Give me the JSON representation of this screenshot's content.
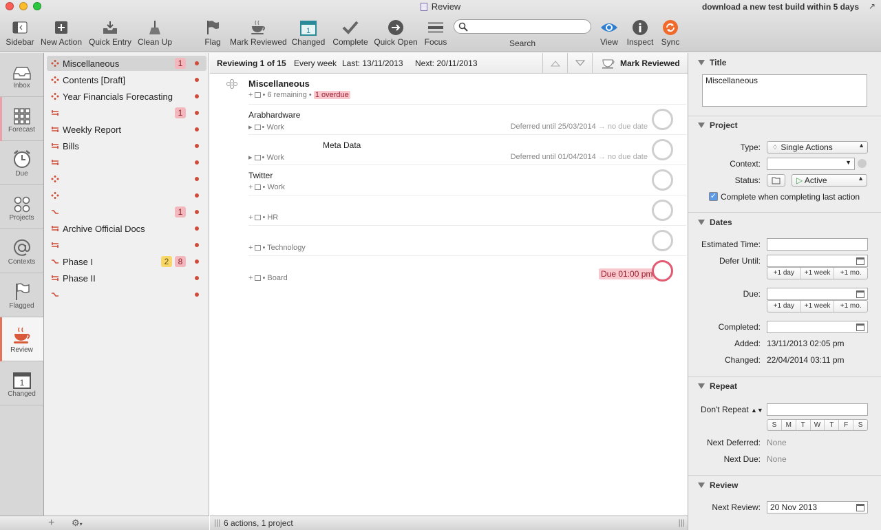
{
  "window": {
    "title": "Review",
    "notice": "download a new test build within 5 days"
  },
  "toolbar": {
    "sidebar": "Sidebar",
    "new_action": "New Action",
    "quick_entry": "Quick Entry",
    "clean_up": "Clean Up",
    "flag": "Flag",
    "mark_reviewed": "Mark Reviewed",
    "changed": "Changed",
    "changed_day": "1",
    "complete": "Complete",
    "quick_open": "Quick Open",
    "focus": "Focus",
    "search_label": "Search",
    "search_placeholder": "",
    "view": "View",
    "inspect": "Inspect",
    "sync": "Sync"
  },
  "perspectives": [
    {
      "label": "Inbox",
      "icon": "inbox-icon"
    },
    {
      "label": "Forecast",
      "icon": "forecast-icon"
    },
    {
      "label": "Due",
      "icon": "alarm-clock-icon"
    },
    {
      "label": "Projects",
      "icon": "projects-icon"
    },
    {
      "label": "Contexts",
      "icon": "at-sign-icon"
    },
    {
      "label": "Flagged",
      "icon": "flag-icon"
    },
    {
      "label": "Review",
      "icon": "teacup-icon"
    },
    {
      "label": "Changed",
      "icon": "calendar-icon",
      "day": "1"
    }
  ],
  "colors": {
    "accent_red": "#d24b38",
    "forecast_bar": "#e8a1a8",
    "review_bar": "#e2735c"
  },
  "projects": [
    {
      "name": "Miscellaneous",
      "type": "single",
      "badges": [
        {
          "v": "1",
          "c": "red"
        }
      ],
      "selected": true
    },
    {
      "name": "Contents [Draft]",
      "type": "single",
      "badges": []
    },
    {
      "name": "Year Financials Forecasting",
      "type": "single",
      "badges": []
    },
    {
      "name": "",
      "type": "parallel",
      "badges": [
        {
          "v": "1",
          "c": "red"
        }
      ]
    },
    {
      "name": "Weekly Report",
      "type": "parallel",
      "badges": []
    },
    {
      "name": "Bills",
      "type": "parallel",
      "badges": []
    },
    {
      "name": "",
      "type": "parallel",
      "badges": []
    },
    {
      "name": "",
      "type": "single",
      "badges": []
    },
    {
      "name": "",
      "type": "single",
      "badges": []
    },
    {
      "name": "",
      "type": "sequential",
      "badges": [
        {
          "v": "1",
          "c": "red"
        }
      ]
    },
    {
      "name": "Archive Official Docs",
      "type": "parallel",
      "badges": []
    },
    {
      "name": "",
      "type": "parallel",
      "badges": []
    },
    {
      "name": "Phase I",
      "type": "sequential",
      "badges": [
        {
          "v": "2",
          "c": "yel"
        },
        {
          "v": "8",
          "c": "red"
        }
      ]
    },
    {
      "name": "Phase II",
      "type": "parallel",
      "badges": []
    },
    {
      "name": "",
      "type": "sequential",
      "badges": []
    }
  ],
  "review": {
    "reviewing": "Reviewing 1 of 15",
    "interval": "Every week",
    "last": "Last: 13/11/2013",
    "next": "Next: 20/11/2013",
    "mark_reviewed": "Mark Reviewed"
  },
  "project": {
    "name": "Miscellaneous",
    "remaining": "6 remaining",
    "overdue": "1 overdue"
  },
  "actions": [
    {
      "title": "Arabhardware",
      "context": "Work",
      "deferred": "Deferred until 25/03/2014",
      "due": "no due date"
    },
    {
      "title": "Meta Data",
      "context": "Work",
      "deferred": "Deferred until 01/04/2014",
      "due": "no due date"
    },
    {
      "title": "Twitter",
      "context": "Work",
      "deferred": "",
      "due": ""
    },
    {
      "title": "",
      "context": "HR",
      "deferred": "",
      "due": ""
    },
    {
      "title": "",
      "context": "Technology",
      "deferred": "",
      "due": ""
    },
    {
      "title": "",
      "context": "Board",
      "deferred": "",
      "due": "",
      "due_badge": "Due 01:00 pm"
    }
  ],
  "footer": {
    "status": "6 actions, 1 project"
  },
  "inspector": {
    "title_header": "Title",
    "title_value": "Miscellaneous",
    "project_header": "Project",
    "type_label": "Type:",
    "type_value": "Single Actions",
    "context_label": "Context:",
    "context_value": "",
    "status_label": "Status:",
    "status_value": "Active",
    "complete_checkbox": "Complete when completing last action",
    "dates_header": "Dates",
    "estimated_label": "Estimated Time:",
    "estimated_value": "",
    "defer_label": "Defer Until:",
    "defer_value": "",
    "plus_day": "+1 day",
    "plus_week": "+1 week",
    "plus_month": "+1 mo.",
    "due_label": "Due:",
    "due_value": "",
    "completed_label": "Completed:",
    "completed_value": "",
    "added_label": "Added:",
    "added_value": "13/11/2013 02:05 pm",
    "changed_label": "Changed:",
    "changed_value": "22/04/2014 03:11 pm",
    "repeat_header": "Repeat",
    "repeat_mode": "Don't Repeat",
    "repeat_value": "",
    "weekdays": [
      "S",
      "M",
      "T",
      "W",
      "T",
      "F",
      "S"
    ],
    "next_deferred_label": "Next Deferred:",
    "next_deferred_value": "None",
    "next_due_label": "Next Due:",
    "next_due_value": "None",
    "review_header": "Review",
    "next_review_label": "Next Review:",
    "next_review_value": "20 Nov 2013"
  }
}
